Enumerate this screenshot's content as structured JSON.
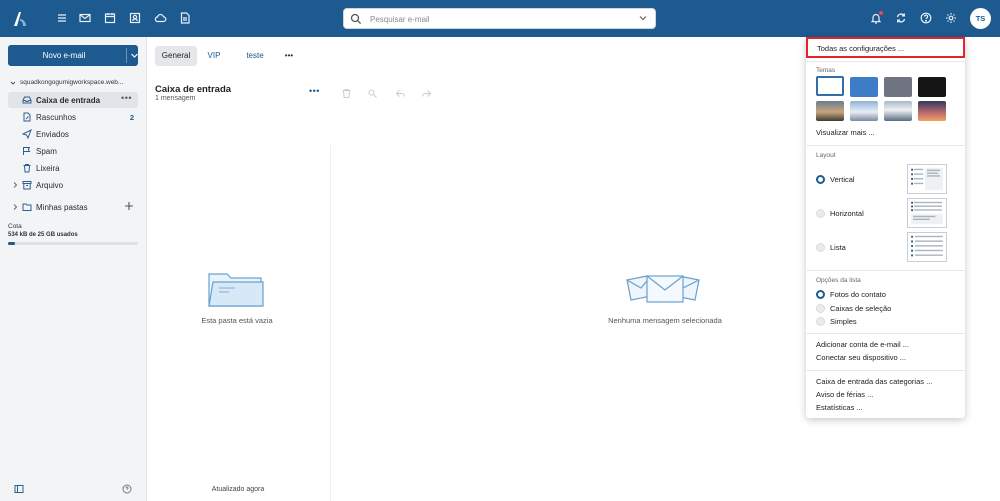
{
  "topbar": {
    "search_placeholder": "Pesquisar e-mail",
    "avatar_initials": "TS",
    "nav_icons": [
      "menu-icon",
      "mail-icon",
      "calendar-icon",
      "contacts-icon",
      "cloud-icon",
      "notes-icon"
    ],
    "right_icons": [
      "bell-icon",
      "sync-icon",
      "help-icon",
      "gear-icon"
    ],
    "brand_color": "#1c5a8f"
  },
  "sidebar": {
    "compose_label": "Novo e-mail",
    "account": "squadkongogumigworkspace.web...",
    "folders": [
      {
        "label": "Caixa de entrada",
        "icon": "inbox-icon",
        "active": true,
        "more": "•••"
      },
      {
        "label": "Rascunhos",
        "icon": "draft-icon",
        "count": "2"
      },
      {
        "label": "Enviados",
        "icon": "send-icon"
      },
      {
        "label": "Spam",
        "icon": "spam-icon"
      },
      {
        "label": "Lixeira",
        "icon": "trash-icon"
      },
      {
        "label": "Arquivo",
        "icon": "archive-icon"
      },
      {
        "label": "Minhas pastas",
        "icon": "folder-icon"
      }
    ],
    "quota_label": "Cota",
    "quota_text": "534 kB de 25 GB usados",
    "quota_fraction": 0.05
  },
  "tabs": [
    {
      "label": "General",
      "active": true
    },
    {
      "label": "VIP"
    },
    {
      "label": "teste"
    },
    {
      "label": "•••"
    }
  ],
  "list": {
    "title": "Caixa de entrada",
    "subtitle": "1 mensagem",
    "more": "•••",
    "empty_text": "Esta pasta está vazia",
    "updated": "Atualizado agora"
  },
  "reader": {
    "empty_text": "Nenhuma mensagem selecionada"
  },
  "settings": {
    "all_settings": "Todas as configurações ...",
    "themes_heading": "Temas",
    "view_more": "Visualizar mais ...",
    "layout_heading": "Layout",
    "layouts": [
      {
        "label": "Vertical",
        "selected": true
      },
      {
        "label": "Horizontal",
        "selected": false
      },
      {
        "label": "Lista",
        "selected": false
      }
    ],
    "list_options_heading": "Opções da lista",
    "list_options": [
      {
        "label": "Fotos do contato",
        "selected": true
      },
      {
        "label": "Caixas de seleção",
        "selected": false
      },
      {
        "label": "Simples",
        "selected": false
      }
    ],
    "add_account": "Adicionar conta de e-mail ...",
    "connect_device": "Conectar seu dispositivo ...",
    "category_inbox": "Caixa de entrada das categorias ...",
    "vacation": "Aviso de férias ...",
    "statistics": "Estatísticas ..."
  }
}
